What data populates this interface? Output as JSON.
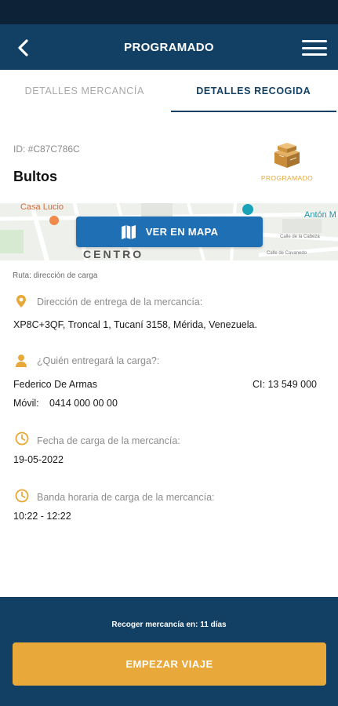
{
  "header": {
    "title": "PROGRAMADO",
    "back_icon": "chevron-left-icon",
    "menu_icon": "hamburger-menu-icon"
  },
  "tabs": [
    {
      "label": "DETALLES MERCANCÍA",
      "active": false
    },
    {
      "label": "DETALLES RECOGIDA",
      "active": true
    }
  ],
  "shipment": {
    "id": "ID: #C87C786C",
    "title": "Bultos",
    "status": "PROGRAMADO",
    "status_icon": "package-boxes-icon"
  },
  "map": {
    "labels": {
      "place": "Casa Lucio",
      "district": "CENTRO",
      "street1": "Calle de la Cabeza",
      "street2": "Calle de Cavanedo",
      "place2": "Antón M"
    },
    "button_label": "VER EN MAPA",
    "button_icon": "map-icon"
  },
  "route_label": "Ruta: dirección de carga",
  "delivery_address": {
    "icon": "location-pin-icon",
    "label": "Dirección de entrega de la mercancía:",
    "value": "XP8C+3QF, Troncal 1, Tucaní 3158, Mérida, Venezuela."
  },
  "sender": {
    "icon": "person-icon",
    "label": "¿Quién entregará la carga?:",
    "name": "Federico De Armas",
    "ci": "CI: 13 549 000",
    "mobile_label": "Móvil:",
    "mobile": "0414 000 00 00"
  },
  "load_date": {
    "icon": "clock-icon",
    "label": "Fecha de carga de la mercancía:",
    "value": "19-05-2022"
  },
  "time_window": {
    "icon": "clock-icon",
    "label": "Banda horaria de carga de la mercancía:",
    "value": "10:22 - 12:22"
  },
  "footer": {
    "countdown": "Recoger mercancía en: 11 días",
    "button_label": "EMPEZAR VIAJE"
  },
  "colors": {
    "primary": "#123f64",
    "accent": "#e8a93a",
    "map_button": "#1f6fb5"
  }
}
